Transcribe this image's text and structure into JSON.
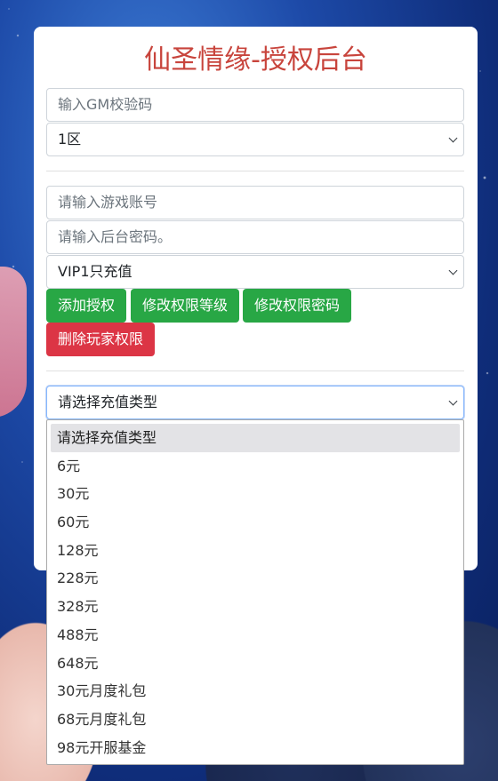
{
  "page_title": "仙圣情缘-授权后台",
  "gm_code": {
    "placeholder": "输入GM校验码"
  },
  "server_select": {
    "value": "1区"
  },
  "account": {
    "placeholder": "请输入游戏账号"
  },
  "password": {
    "placeholder": "请输入后台密码。"
  },
  "vip_select": {
    "value": "VIP1只充值"
  },
  "buttons": {
    "add": "添加授权",
    "modify_level": "修改权限等级",
    "modify_password": "修改权限密码",
    "delete": "删除玩家权限"
  },
  "recharge_select": {
    "value": "请选择充值类型",
    "options": [
      "请选择充值类型",
      "6元",
      "30元",
      "60元",
      "128元",
      "228元",
      "328元",
      "488元",
      "648元",
      "30元月度礼包",
      "68元月度礼包",
      "98元开服基金"
    ]
  },
  "colors": {
    "title": "#c8443c",
    "green_button": "#28a745",
    "red_button": "#dc3545"
  }
}
